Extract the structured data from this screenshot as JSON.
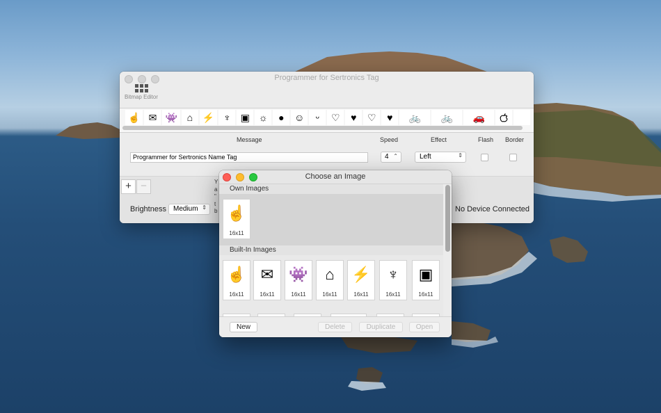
{
  "main_window": {
    "title": "Programmer for Sertronics Tag",
    "toolbar": {
      "bitmap_editor_label": "Bitmap Editor"
    },
    "symbol_strip": [
      "☝",
      "✉",
      "👾",
      "⌂",
      "⚡",
      "♆",
      "▣",
      "☼",
      "●",
      "☺",
      "ᵕ",
      "♡",
      "♥",
      "♡",
      "♥",
      "🚲",
      "🚲",
      "🚗",
      ""
    ],
    "columns": {
      "message": "Message",
      "speed": "Speed",
      "effect": "Effect",
      "flash": "Flash",
      "border": "Border"
    },
    "row": {
      "message": "Programmer for Sertronics Name Tag",
      "speed": "4",
      "effect": "Left"
    },
    "add_label": "+",
    "remove_label": "−",
    "brightness": {
      "label": "Brightness",
      "value": "Medium"
    },
    "status": "No Device Connected",
    "partial_text": [
      "Y",
      "a",
      "\"",
      "t",
      "b"
    ]
  },
  "dialog": {
    "title": "Choose an Image",
    "own_images": {
      "header": "Own Images",
      "items": [
        {
          "glyph": "☝",
          "size": "16x11"
        }
      ]
    },
    "builtin_images": {
      "header": "Built-In Images",
      "items": [
        {
          "glyph": "☝",
          "size": "16x11"
        },
        {
          "glyph": "✉",
          "size": "16x11"
        },
        {
          "glyph": "👾",
          "size": "16x11"
        },
        {
          "glyph": "⌂",
          "size": "16x11"
        },
        {
          "glyph": "⚡",
          "size": "16x11"
        },
        {
          "glyph": "♆",
          "size": "16x11"
        },
        {
          "glyph": "▣",
          "size": "16x11"
        }
      ]
    },
    "buttons": {
      "new": "New",
      "delete": "Delete",
      "duplicate": "Duplicate",
      "open": "Open"
    }
  }
}
